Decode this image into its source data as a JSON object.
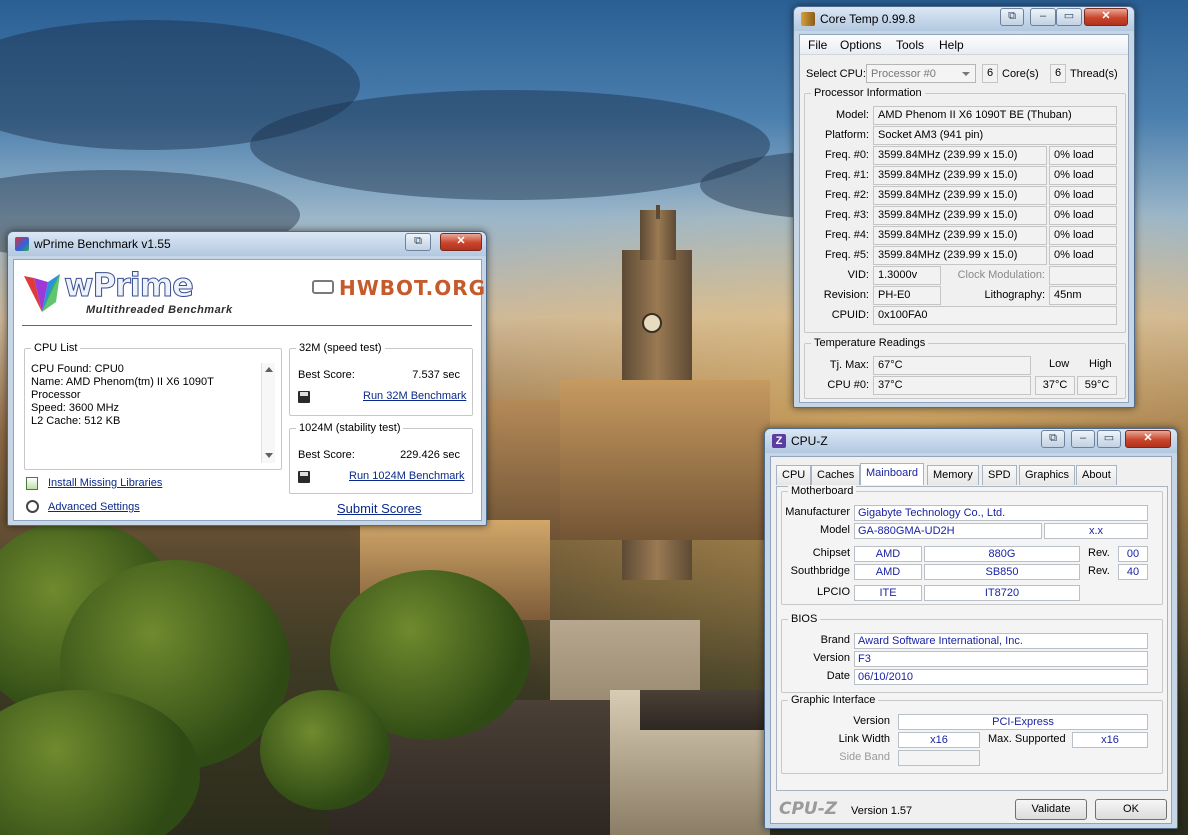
{
  "wprime": {
    "title": "wPrime Benchmark v1.55",
    "logo_text": "wPrime",
    "logo_subtitle": "Multithreaded Benchmark",
    "hwbot_logo": "HWBOT.ORG",
    "cpu_list_label": "CPU List",
    "cpu_list_lines": [
      "CPU Found: CPU0",
      "Name:    AMD Phenom(tm) II X6 1090T",
      "Processor",
      "Speed:    3600 MHz",
      "L2 Cache: 512 KB"
    ],
    "test32_label": "32M (speed test)",
    "test32_best_label": "Best Score:",
    "test32_best_value": "7.537 sec",
    "test32_run": "Run 32M Benchmark",
    "test1024_label": "1024M (stability test)",
    "test1024_best_label": "Best Score:",
    "test1024_best_value": "229.426 sec",
    "test1024_run": "Run 1024M Benchmark",
    "install_libs": "Install Missing Libraries",
    "advanced_settings": "Advanced Settings",
    "submit_scores": "Submit Scores"
  },
  "coretemp": {
    "title": "Core Temp 0.99.8",
    "menu": [
      "File",
      "Options",
      "Tools",
      "Help"
    ],
    "select_cpu_label": "Select CPU:",
    "select_cpu_value": "Processor #0",
    "cores_value": "6",
    "cores_label": "Core(s)",
    "threads_value": "6",
    "threads_label": "Thread(s)",
    "proc_info_label": "Processor Information",
    "model_label": "Model:",
    "model_value": "AMD Phenom II X6 1090T BE (Thuban)",
    "platform_label": "Platform:",
    "platform_value": "Socket AM3 (941 pin)",
    "freqs": [
      {
        "label": "Freq. #0:",
        "value": "3599.84MHz (239.99 x 15.0)",
        "load": "0% load"
      },
      {
        "label": "Freq. #1:",
        "value": "3599.84MHz (239.99 x 15.0)",
        "load": "0% load"
      },
      {
        "label": "Freq. #2:",
        "value": "3599.84MHz (239.99 x 15.0)",
        "load": "0% load"
      },
      {
        "label": "Freq. #3:",
        "value": "3599.84MHz (239.99 x 15.0)",
        "load": "0% load"
      },
      {
        "label": "Freq. #4:",
        "value": "3599.84MHz (239.99 x 15.0)",
        "load": "0% load"
      },
      {
        "label": "Freq. #5:",
        "value": "3599.84MHz (239.99 x 15.0)",
        "load": "0% load"
      }
    ],
    "vid_label": "VID:",
    "vid_value": "1.3000v",
    "clock_mod_label": "Clock Modulation:",
    "clock_mod_value": "",
    "revision_label": "Revision:",
    "revision_value": "PH-E0",
    "litho_label": "Lithography:",
    "litho_value": "45nm",
    "cpuid_label": "CPUID:",
    "cpuid_value": "0x100FA0",
    "temp_label": "Temperature Readings",
    "low_label": "Low",
    "high_label": "High",
    "tjmax_label": "Tj. Max:",
    "tjmax_value": "67°C",
    "cpu0_label": "CPU #0:",
    "cpu0_value": "37°C",
    "cpu0_low": "37°C",
    "cpu0_high": "59°C"
  },
  "cpuz": {
    "title": "CPU-Z",
    "tabs": [
      "CPU",
      "Caches",
      "Mainboard",
      "Memory",
      "SPD",
      "Graphics",
      "About"
    ],
    "active_tab": "Mainboard",
    "motherboard_label": "Motherboard",
    "manufacturer_label": "Manufacturer",
    "manufacturer_value": "Gigabyte Technology Co., Ltd.",
    "model_label": "Model",
    "model_value": "GA-880GMA-UD2H",
    "model_rev": "x.x",
    "chipset_label": "Chipset",
    "chipset_vendor": "AMD",
    "chipset_model": "880G",
    "chipset_rev_label": "Rev.",
    "chipset_rev": "00",
    "southbridge_label": "Southbridge",
    "southbridge_vendor": "AMD",
    "southbridge_model": "SB850",
    "southbridge_rev_label": "Rev.",
    "southbridge_rev": "40",
    "lpcio_label": "LPCIO",
    "lpcio_vendor": "ITE",
    "lpcio_model": "IT8720",
    "bios_label": "BIOS",
    "brand_label": "Brand",
    "brand_value": "Award Software International, Inc.",
    "version_label": "Version",
    "version_value": "F3",
    "date_label": "Date",
    "date_value": "06/10/2010",
    "graphic_label": "Graphic Interface",
    "gi_version_label": "Version",
    "gi_version_value": "PCI-Express",
    "link_width_label": "Link Width",
    "link_width_value": "x16",
    "max_supported_label": "Max. Supported",
    "max_supported_value": "x16",
    "side_band_label": "Side Band",
    "side_band_value": "",
    "footer_logo": "CPU-Z",
    "footer_version": "Version 1.57",
    "validate": "Validate",
    "ok": "OK"
  }
}
